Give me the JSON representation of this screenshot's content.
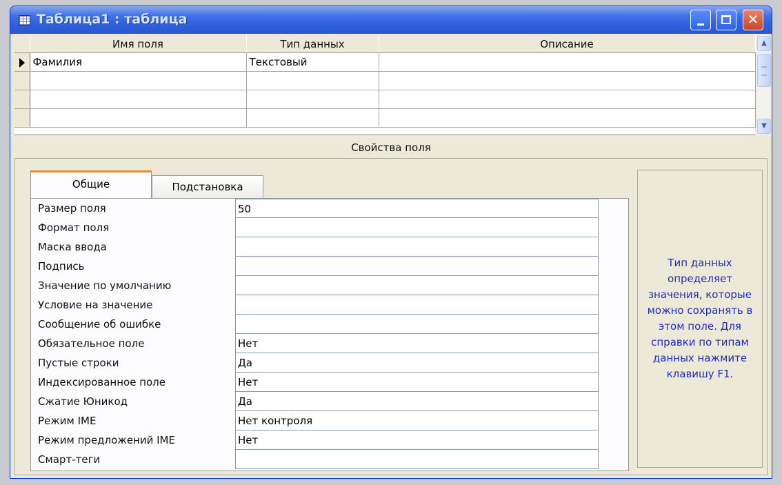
{
  "window": {
    "title": "Таблица1 : таблица",
    "icon": "table-icon",
    "controls": {
      "minimize_icon": "minimize-icon",
      "maximize_icon": "maximize-icon",
      "close_icon": "close-icon"
    }
  },
  "grid": {
    "headers": [
      "Имя поля",
      "Тип данных",
      "Описание"
    ],
    "rows": [
      {
        "name": "Фамилия",
        "type": "Текстовый",
        "description": ""
      },
      {
        "name": "",
        "type": "",
        "description": ""
      },
      {
        "name": "",
        "type": "",
        "description": ""
      },
      {
        "name": "",
        "type": "",
        "description": ""
      }
    ]
  },
  "properties": {
    "section_label": "Свойства поля",
    "tabs": [
      "Общие",
      "Подстановка"
    ],
    "active_tab": "Общие",
    "rows": [
      {
        "label": "Размер поля",
        "value": "50"
      },
      {
        "label": "Формат поля",
        "value": ""
      },
      {
        "label": "Маска ввода",
        "value": ""
      },
      {
        "label": "Подпись",
        "value": ""
      },
      {
        "label": "Значение по умолчанию",
        "value": ""
      },
      {
        "label": "Условие на значение",
        "value": ""
      },
      {
        "label": "Сообщение об ошибке",
        "value": ""
      },
      {
        "label": "Обязательное поле",
        "value": "Нет"
      },
      {
        "label": "Пустые строки",
        "value": "Да"
      },
      {
        "label": "Индексированное поле",
        "value": "Нет"
      },
      {
        "label": "Сжатие Юникод",
        "value": "Да"
      },
      {
        "label": "Режим IME",
        "value": "Нет контроля"
      },
      {
        "label": "Режим предложений IME",
        "value": "Нет"
      },
      {
        "label": "Смарт-теги",
        "value": ""
      }
    ]
  },
  "help": {
    "text": "Тип данных определяет значения, которые можно сохранять в этом поле.  Для справки по типам данных нажмите клавишу F1."
  },
  "colors": {
    "help_text": "#1c2fb8",
    "title_bar": "#2f5fdb",
    "tab_accent": "#e68b2c"
  }
}
